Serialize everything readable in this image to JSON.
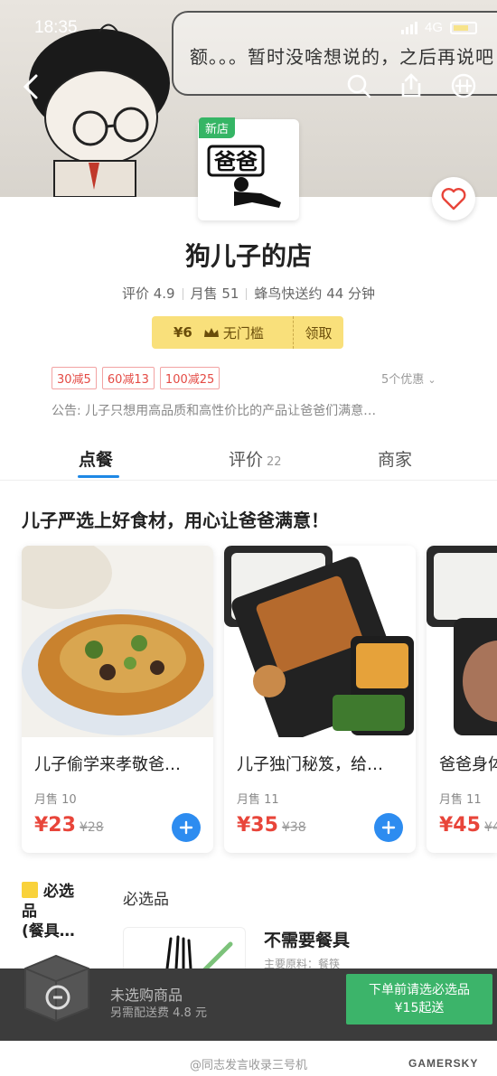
{
  "status_bar": {
    "time": "18:35",
    "network": "4G"
  },
  "banner": {
    "speech_text": "额。。。暂时没啥想说的，之后再说吧"
  },
  "store": {
    "new_badge": "新店",
    "logo_text": "爸爸",
    "name": "狗儿子的店",
    "rating": "评价 4.9",
    "monthly_sales": "月售 51",
    "delivery": "蜂鸟快送约 44 分钟"
  },
  "coupon": {
    "amount": "¥6",
    "condition": "无门槛",
    "claim_label": "领取"
  },
  "promotions": {
    "tags": [
      "30减5",
      "60减13",
      "100减25"
    ],
    "more_label": "5个优惠"
  },
  "notice": "公告: 儿子只想用高品质和高性价比的产品让爸爸们满意…",
  "tabs": [
    {
      "label": "点餐",
      "count": ""
    },
    {
      "label": "评价",
      "count": "22"
    },
    {
      "label": "商家",
      "count": ""
    }
  ],
  "featured": {
    "title": "儿子严选上好食材，用心让爸爸满意！",
    "items": [
      {
        "name": "儿子偷学来孝敬爸…",
        "sales": "月售 10",
        "price": "¥23",
        "original_price": "¥28"
      },
      {
        "name": "儿子独门秘笈，给…",
        "sales": "月售 11",
        "price": "¥35",
        "original_price": "¥38"
      },
      {
        "name": "爸爸身体…",
        "sales": "月售 11",
        "price": "¥45",
        "original_price": "¥4"
      }
    ]
  },
  "category": {
    "side_label_line1": "必选",
    "side_label_line2": "品",
    "side_label_line3": "(餐具…",
    "header": "必选品",
    "item_title": "不需要餐具",
    "item_desc": "主要原料：餐筷"
  },
  "bottom_bar": {
    "title": "未选购商品",
    "subtitle": "另需配送费 4.8 元",
    "checkout_line1": "下单前请选必选品",
    "checkout_line2": "¥15起送"
  },
  "footer": {
    "watermark": "@同志发言收录三号机",
    "brand": "GAMERSKY"
  },
  "colors": {
    "accent_blue": "#2d8cf0",
    "price_red": "#e8453a",
    "checkout_green": "#3cb46a",
    "coupon_yellow": "#f9e07b"
  }
}
